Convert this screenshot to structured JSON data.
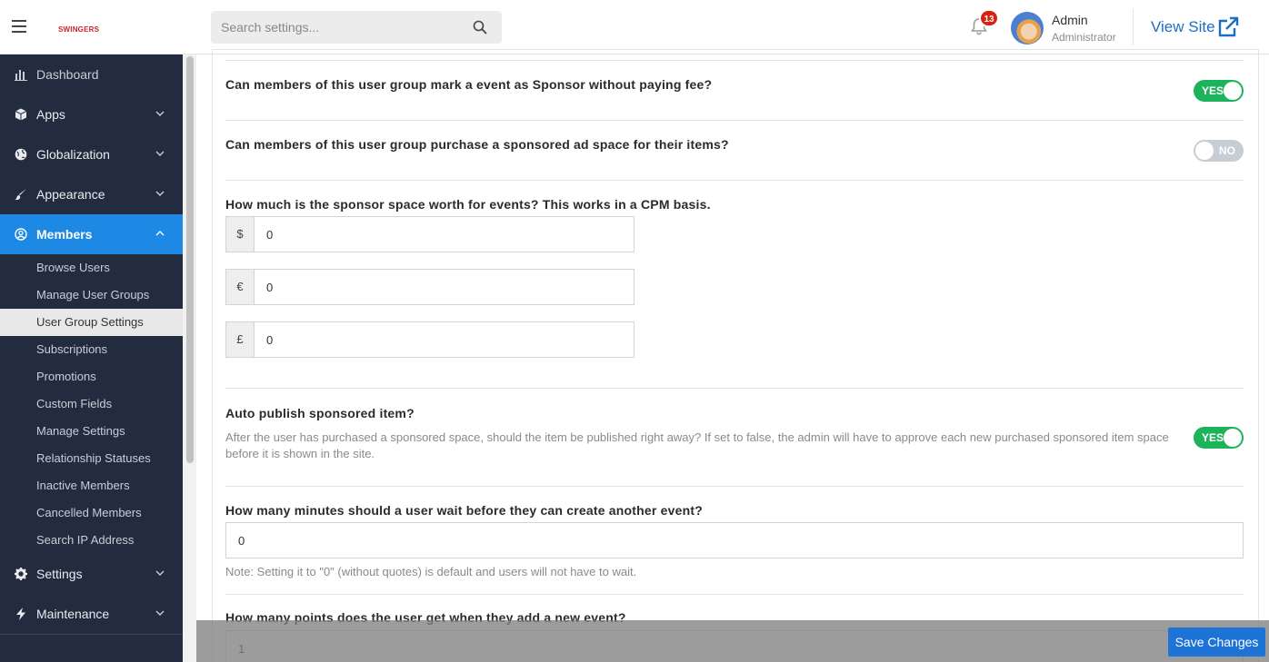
{
  "header": {
    "logo_text": "SWINGERS",
    "search_placeholder": "Search settings...",
    "notification_count": "13",
    "user_name": "Admin",
    "user_role": "Administrator",
    "view_site_label": "View Site"
  },
  "sidebar": {
    "items": [
      {
        "label": "Dashboard",
        "icon": "bar-chart-icon"
      },
      {
        "label": "Apps",
        "icon": "cube-icon"
      },
      {
        "label": "Globalization",
        "icon": "globe-icon"
      },
      {
        "label": "Appearance",
        "icon": "brush-icon"
      },
      {
        "label": "Members",
        "icon": "user-circle-icon"
      },
      {
        "label": "Settings",
        "icon": "gear-icon"
      },
      {
        "label": "Maintenance",
        "icon": "bolt-icon"
      }
    ],
    "members_sub": [
      "Browse Users",
      "Manage User Groups",
      "User Group Settings",
      "Subscriptions",
      "Promotions",
      "Custom Fields",
      "Manage Settings",
      "Relationship Statuses",
      "Inactive Members",
      "Cancelled Members",
      "Search IP Address"
    ]
  },
  "settings": {
    "q_sponsor_without_fee": "Can members of this user group mark a event as Sponsor without paying fee?",
    "sponsor_without_fee_value": "YES",
    "q_purchase_ad_space": "Can members of this user group purchase a sponsored ad space for their items?",
    "purchase_ad_space_value": "NO",
    "q_sponsor_worth": "How much is the sponsor space worth for events? This works in a CPM basis.",
    "currencies": [
      {
        "symbol": "$",
        "value": "0"
      },
      {
        "symbol": "€",
        "value": "0"
      },
      {
        "symbol": "£",
        "value": "0"
      }
    ],
    "q_auto_publish": "Auto publish sponsored item?",
    "auto_publish_desc": "After the user has purchased a sponsored space, should the item be published right away? If set to false, the admin will have to approve each new purchased sponsored item space before it is shown in the site.",
    "auto_publish_value": "YES",
    "q_wait_minutes": "How many minutes should a user wait before they can create another event?",
    "wait_minutes_value": "0",
    "wait_minutes_note": "Note: Setting it to \"0\" (without quotes) is default and users will not have to wait.",
    "q_points": "How many points does the user get when they add a new event?",
    "points_value": "1"
  },
  "footer": {
    "save_label": "Save Changes"
  }
}
